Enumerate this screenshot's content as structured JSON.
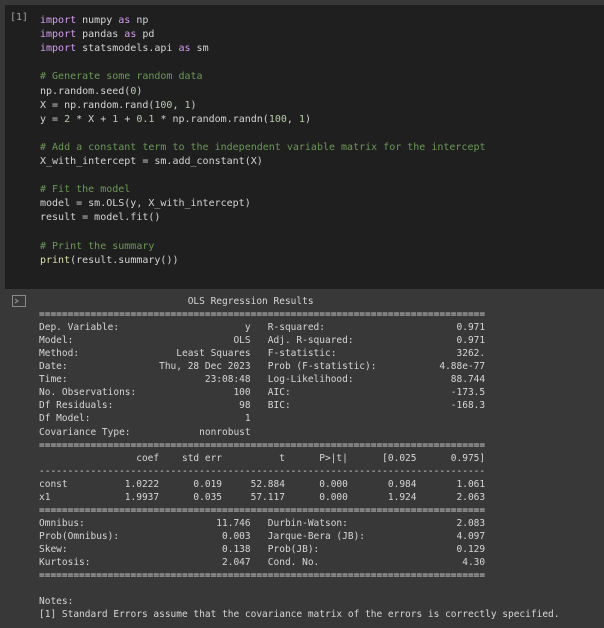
{
  "cell": {
    "prompt": "[1]",
    "code_lines": [
      "import numpy as np",
      "import pandas as pd",
      "import statsmodels.api as sm",
      "",
      "# Generate some random data",
      "np.random.seed(0)",
      "X = np.random.rand(100, 1)",
      "y = 2 * X + 1 + 0.1 * np.random.randn(100, 1)",
      "",
      "# Add a constant term to the independent variable matrix for the intercept",
      "X_with_intercept = sm.add_constant(X)",
      "",
      "# Fit the model",
      "model = sm.OLS(y, X_with_intercept)",
      "result = model.fit()",
      "",
      "# Print the summary",
      "print(result.summary())"
    ]
  },
  "output": {
    "lines": [
      "                          OLS Regression Results",
      "==============================================================================",
      "Dep. Variable:                      y   R-squared:                       0.971",
      "Model:                            OLS   Adj. R-squared:                  0.971",
      "Method:                 Least Squares   F-statistic:                     3262.",
      "Date:                Thu, 28 Dec 2023   Prob (F-statistic):           4.88e-77",
      "Time:                        23:08:48   Log-Likelihood:                 88.744",
      "No. Observations:                 100   AIC:                            -173.5",
      "Df Residuals:                      98   BIC:                            -168.3",
      "Df Model:                           1",
      "Covariance Type:            nonrobust",
      "==============================================================================",
      "                 coef    std err          t      P>|t|      [0.025      0.975]",
      "------------------------------------------------------------------------------",
      "const          1.0222      0.019     52.884      0.000       0.984       1.061",
      "x1             1.9937      0.035     57.117      0.000       1.924       2.063",
      "==============================================================================",
      "Omnibus:                       11.746   Durbin-Watson:                   2.083",
      "Prob(Omnibus):                  0.003   Jarque-Bera (JB):                4.097",
      "Skew:                           0.138   Prob(JB):                        0.129",
      "Kurtosis:                       2.047   Cond. No.                         4.30",
      "==============================================================================",
      "",
      "Notes:",
      "[1] Standard Errors assume that the covariance matrix of the errors is correctly specified."
    ]
  }
}
